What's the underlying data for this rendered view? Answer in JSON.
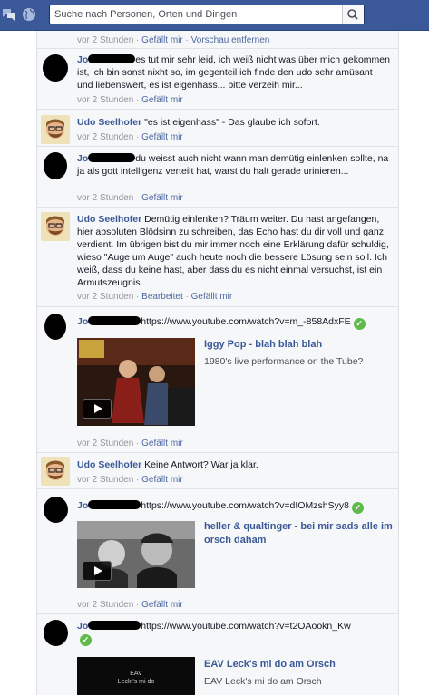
{
  "search": {
    "placeholder": "Suche nach Personen, Orten und Dingen"
  },
  "colors": {
    "brand": "#3b5998",
    "link": "#4e69a2",
    "meta": "#90949c",
    "check": "#5fb94c"
  },
  "meta_top": {
    "time": "vor 2 Stunden",
    "like": "Gefällt mir",
    "remove_preview": "Vorschau entfernen",
    "sep": "·"
  },
  "comments": [
    {
      "name": "Jo",
      "text": "es tut mir sehr leid, ich weiß nicht was über mich gekommen ist, ich bin sonst nixht so, im gegenteil ich finde den udo sehr amüsant und liebenswert, es ist eigenhass... bitte verzeih mir...",
      "time": "vor 2 Stunden",
      "like": "Gefällt mir"
    },
    {
      "name": "Udo Seelhofer",
      "text": "\"es ist eigenhass\" - Das glaube ich sofort.",
      "time": "vor 2 Stunden",
      "like": "Gefällt mir"
    },
    {
      "name": "Jo",
      "text": "du weisst auch nicht wann man demütig einlenken sollte, na ja als gott intelligenz verteilt hat, warst du halt gerade urinieren...",
      "time": "vor 2 Stunden",
      "like": "Gefällt mir"
    },
    {
      "name": "Udo Seelhofer",
      "text": "Demütig einlenken? Träum weiter. Du hast angefangen, hier absoluten Blödsinn zu schreiben, das Echo hast du dir voll und ganz verdient. Im übrigen bist du mir immer noch eine Erklärung dafür schuldig, wieso \"Auge um Auge\" auch heute noch die bessere Lösung sein soll. Ich weiß, dass du keine hast, aber dass du es nicht einmal versuchst, ist ein Armutszeugnis.",
      "time": "vor 2 Stunden",
      "edited": "Bearbeitet",
      "like": "Gefällt mir"
    },
    {
      "name": "Jo",
      "url": "https://www.youtube.com/watch?v=m_-858AdxFE",
      "video_title": "Iggy Pop - blah blah blah",
      "video_desc": "1980's live performance on the Tube?",
      "time": "vor 2 Stunden",
      "like": "Gefällt mir"
    },
    {
      "name": "Udo Seelhofer",
      "text": "Keine Antwort? War ja klar.",
      "time": "vor 2 Stunden",
      "like": "Gefällt mir"
    },
    {
      "name": "Jo",
      "url": "https://www.youtube.com/watch?v=dIOMzshSyy8",
      "video_title": "heller & qualtinger - bei mir sads alle im orsch daham",
      "time": "vor 2 Stunden",
      "like": "Gefällt mir"
    },
    {
      "name": "Jo",
      "url": "https://www.youtube.com/watch?v=t2OAookn_Kw",
      "video_title": "EAV Leck's mi do am Orsch",
      "video_desc": "EAV Leck's mi do am Orsch",
      "thumb_text_1": "EAV",
      "thumb_text_2": "Leckt's mi do"
    }
  ]
}
